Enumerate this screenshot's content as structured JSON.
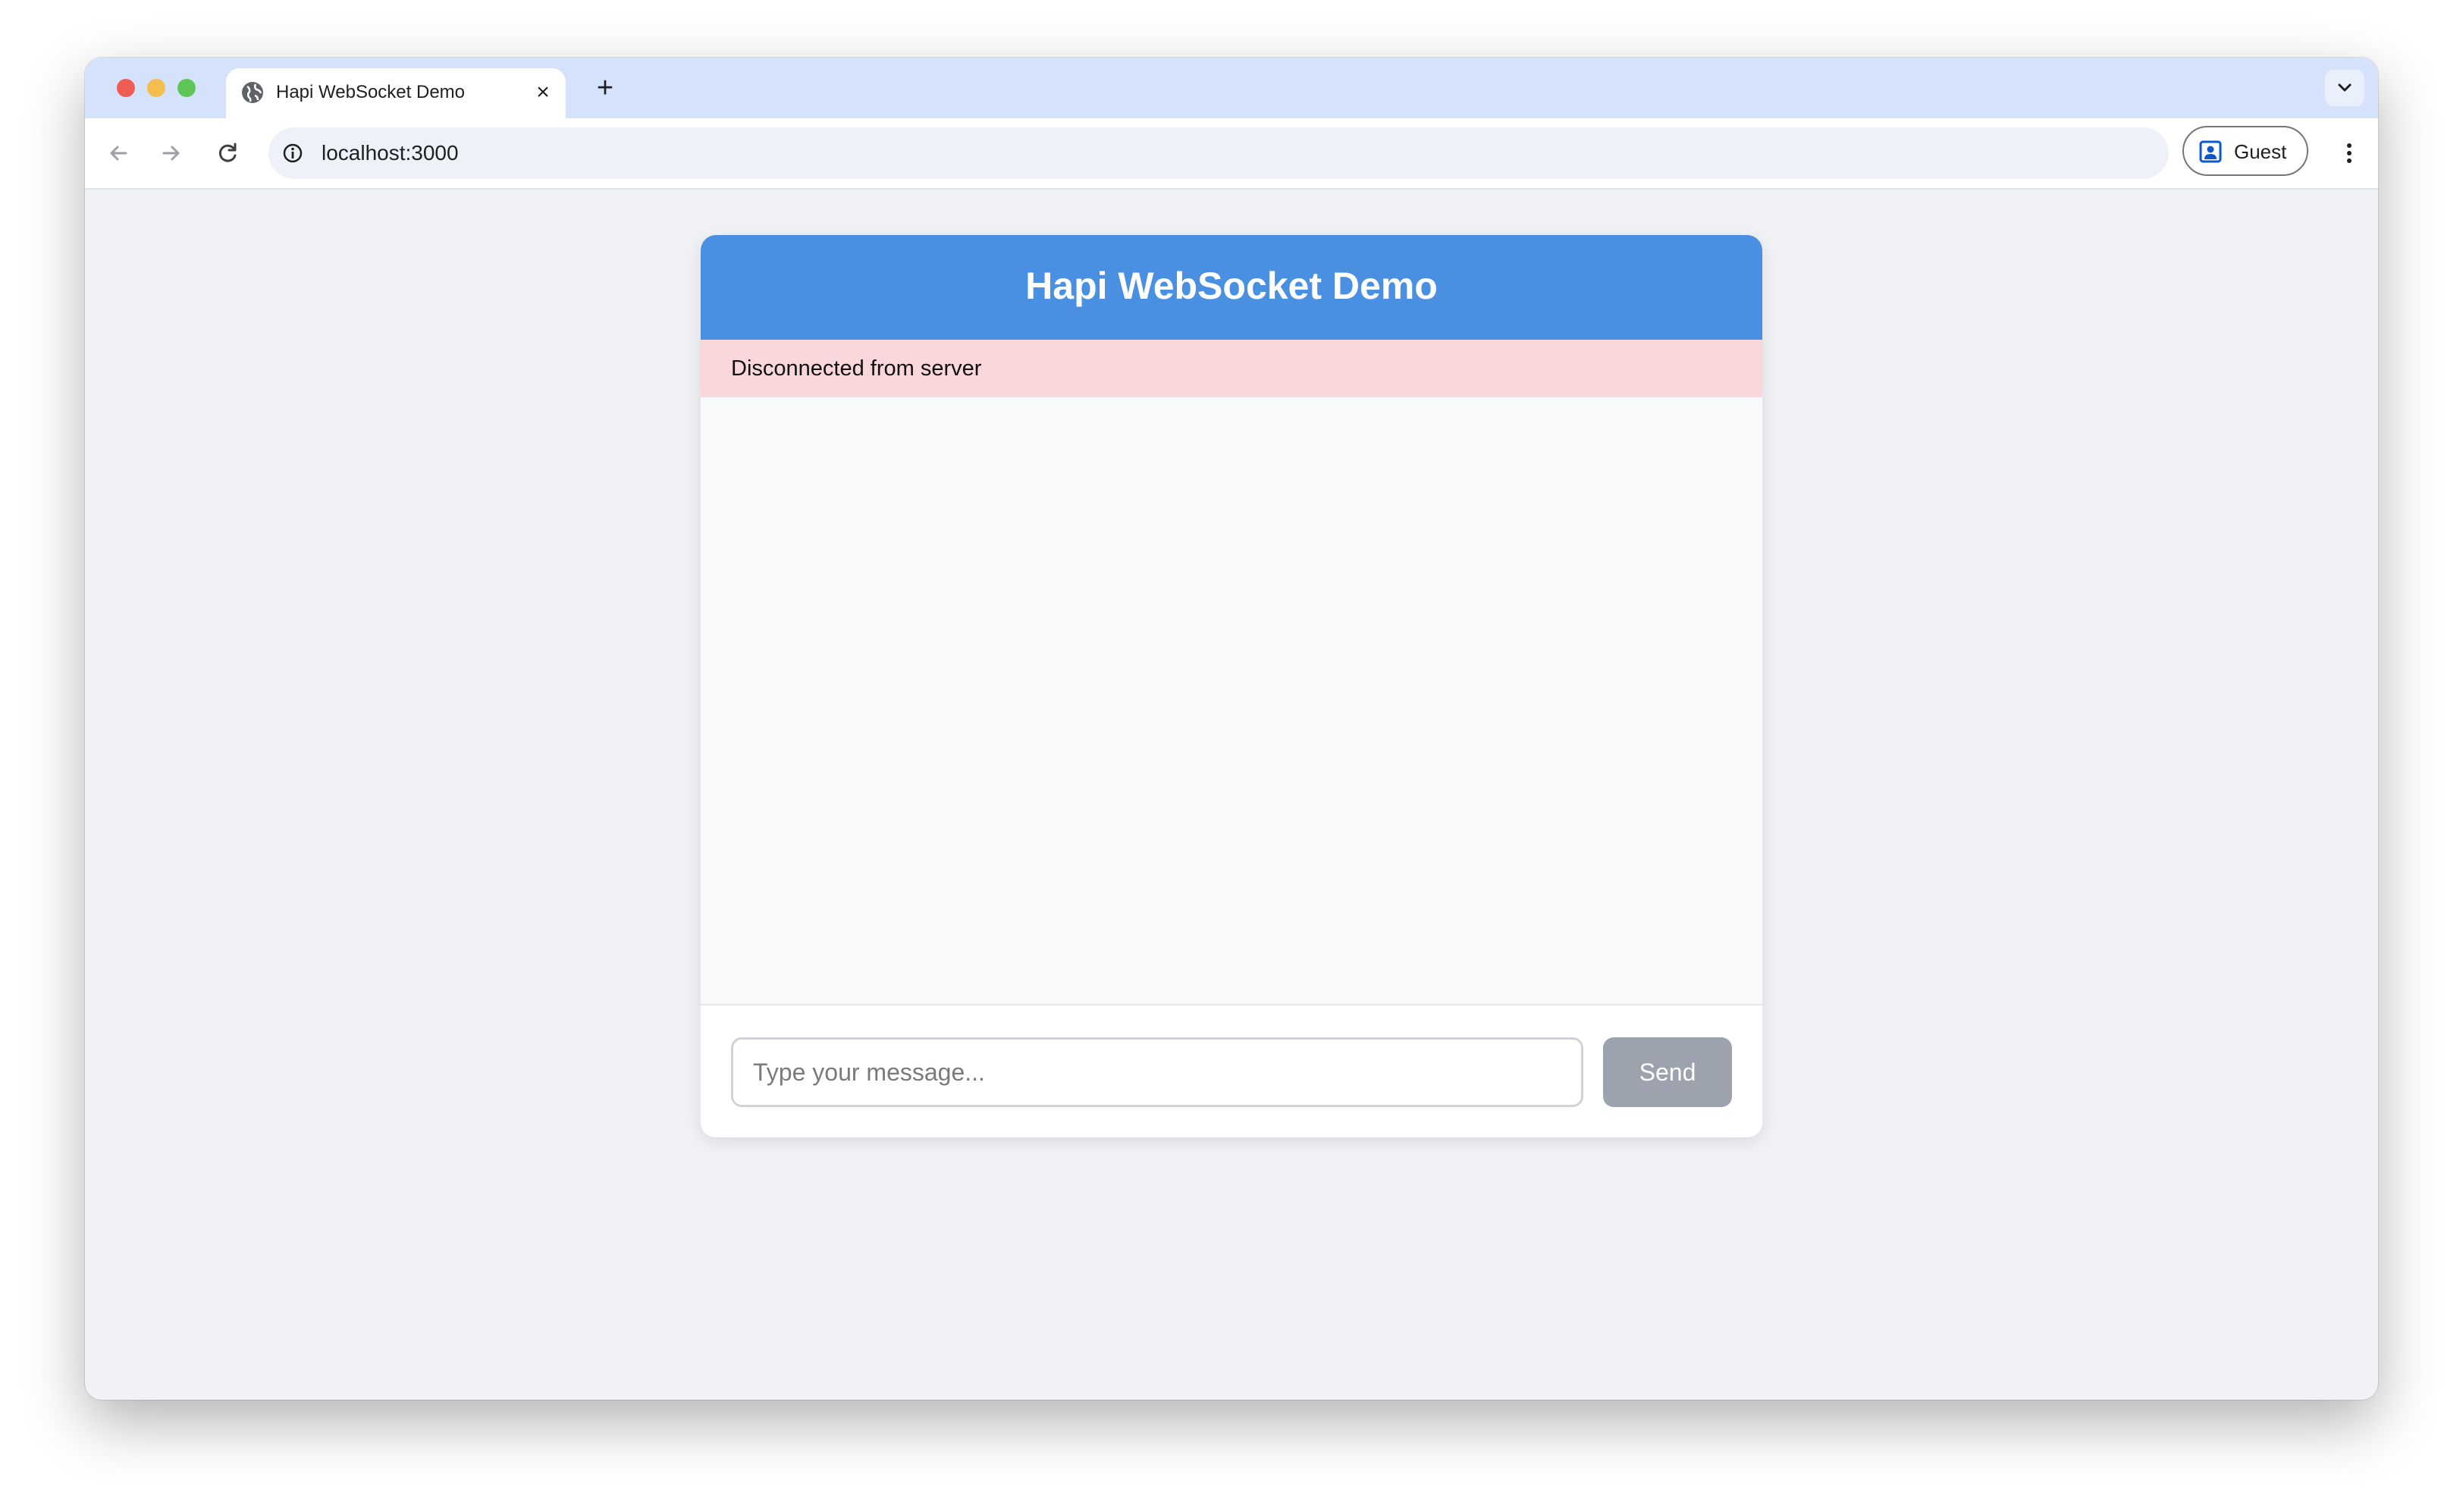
{
  "browser": {
    "tab": {
      "title": "Hapi WebSocket Demo",
      "close_glyph": "×",
      "favicon": "globe-icon"
    },
    "new_tab_glyph": "+",
    "address_bar": {
      "url": "localhost:3000",
      "info_icon": "info-icon"
    },
    "profile": {
      "label": "Guest",
      "icon": "person-badge-icon"
    },
    "nav_icons": [
      "back-arrow-icon",
      "forward-arrow-icon",
      "reload-icon"
    ],
    "menu_icon": "kebab-menu-icon"
  },
  "app": {
    "title": "Hapi WebSocket Demo",
    "status": {
      "text": "Disconnected from server",
      "color": "#f9d7da"
    },
    "composer": {
      "placeholder": "Type your message...",
      "send_label": "Send"
    },
    "colors": {
      "header": "#4a90e2",
      "send_disabled": "#9ca3ae",
      "background": "#f0f2f5"
    }
  }
}
